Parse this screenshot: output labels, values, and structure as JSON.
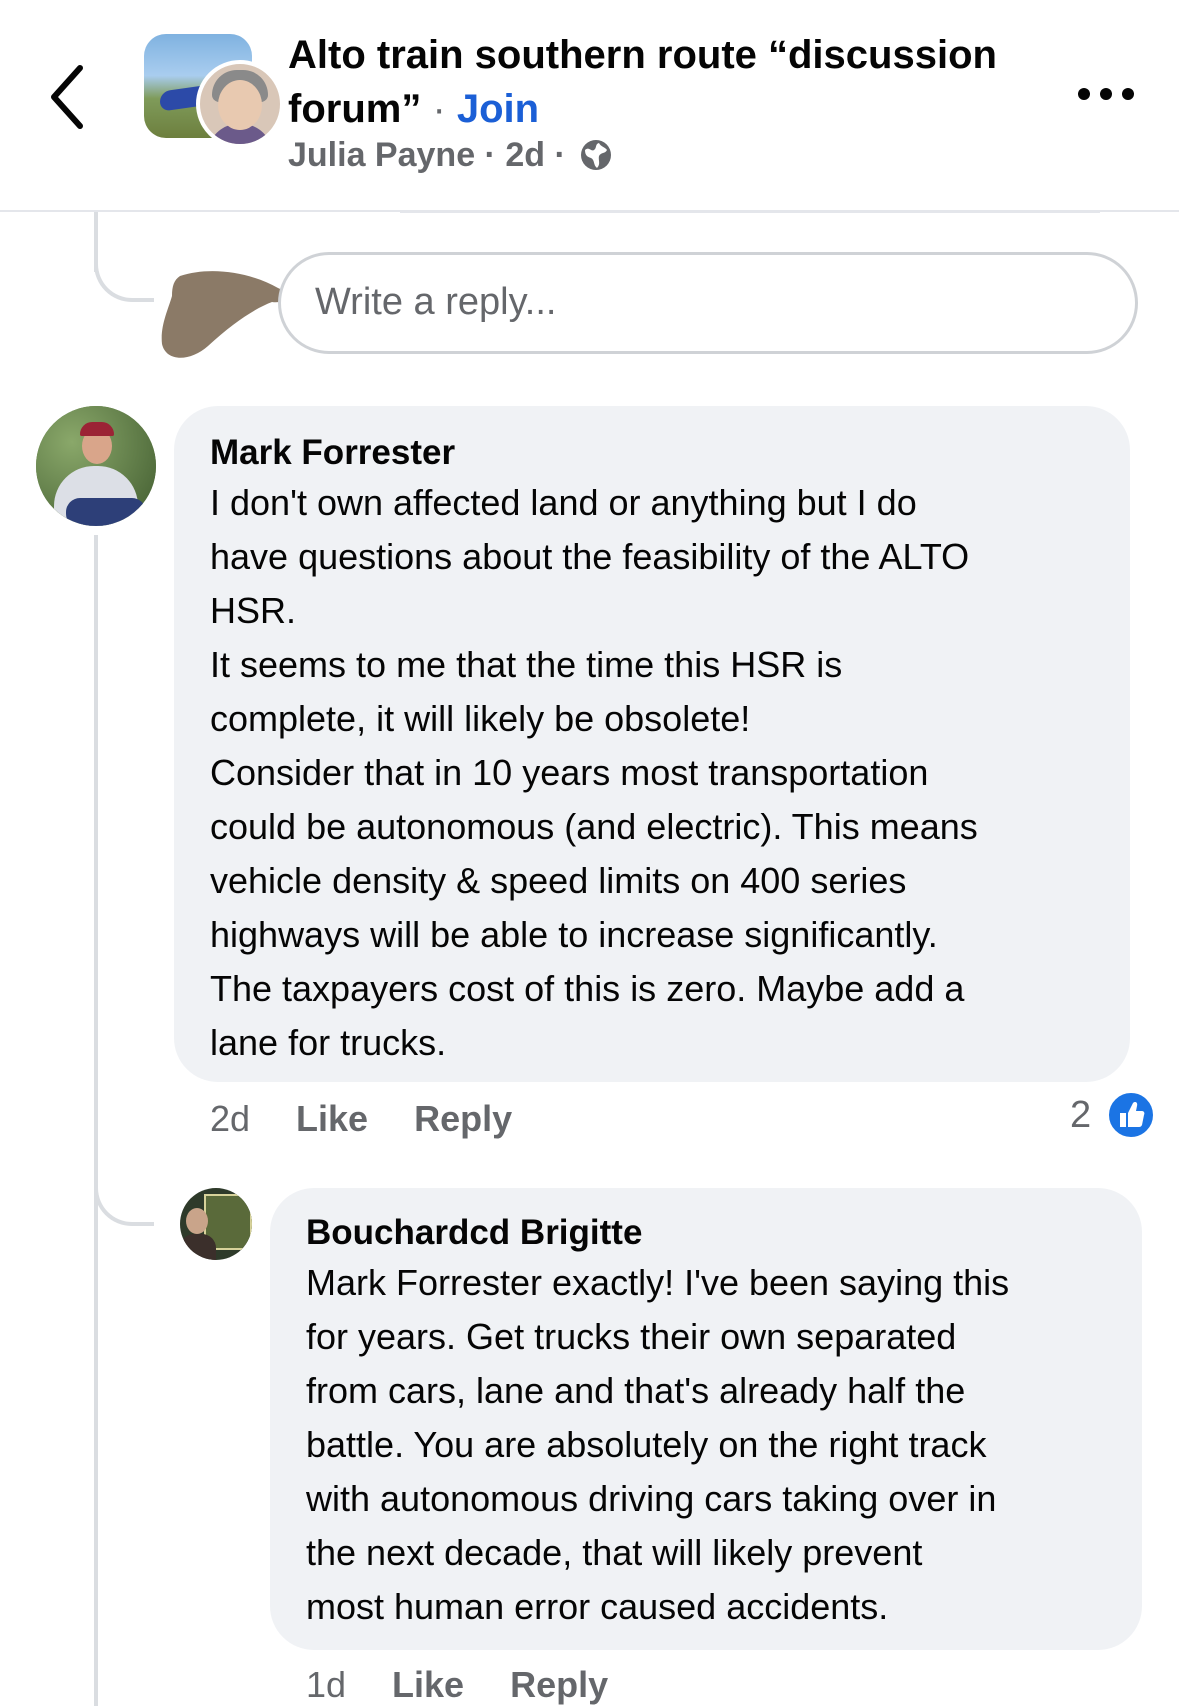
{
  "header": {
    "group_title": "Alto train southern route “discussion forum”",
    "separator": " · ",
    "join_label": "Join",
    "author": "Julia Payne",
    "dot": " · ",
    "age": "2d",
    "dot2": " · ",
    "privacy_icon": "globe-icon",
    "back_icon": "chevron-left-icon",
    "more_icon": "more-horizontal-icon"
  },
  "composer": {
    "placeholder": "Write a reply..."
  },
  "comments": [
    {
      "author": "Mark Forrester",
      "lines": [
        "I don't own affected land or anything but I do",
        "have questions about the feasibility of the ALTO",
        "HSR.",
        "It seems to me that the time this HSR is",
        "complete, it will likely be obsolete!",
        "Consider that in 10 years most transportation",
        "could be autonomous (and electric).  This means",
        "vehicle density & speed limits on 400 series",
        "highways will be able to increase significantly.",
        "The taxpayers cost of this is zero. Maybe add a",
        "lane for trucks."
      ],
      "age": "2d",
      "like_label": "Like",
      "reply_label": "Reply",
      "reaction_count": "2",
      "reaction_icon": "thumbs-up-icon"
    },
    {
      "author": "Bouchardcd Brigitte",
      "lines": [
        "Mark Forrester exactly! I've been saying this",
        "for years. Get trucks their own separated",
        "from cars, lane and that's already half the",
        "battle.  You are absolutely on the right track",
        "with autonomous driving cars taking over in",
        "the next decade, that will likely prevent",
        "most human error caused accidents."
      ],
      "age": "1d",
      "like_label": "Like",
      "reply_label": "Reply"
    }
  ],
  "colors": {
    "accent": "#1b5fd6",
    "bubble": "#f0f2f5",
    "secondary_text": "#65676b",
    "thread_line": "#dadde1"
  }
}
